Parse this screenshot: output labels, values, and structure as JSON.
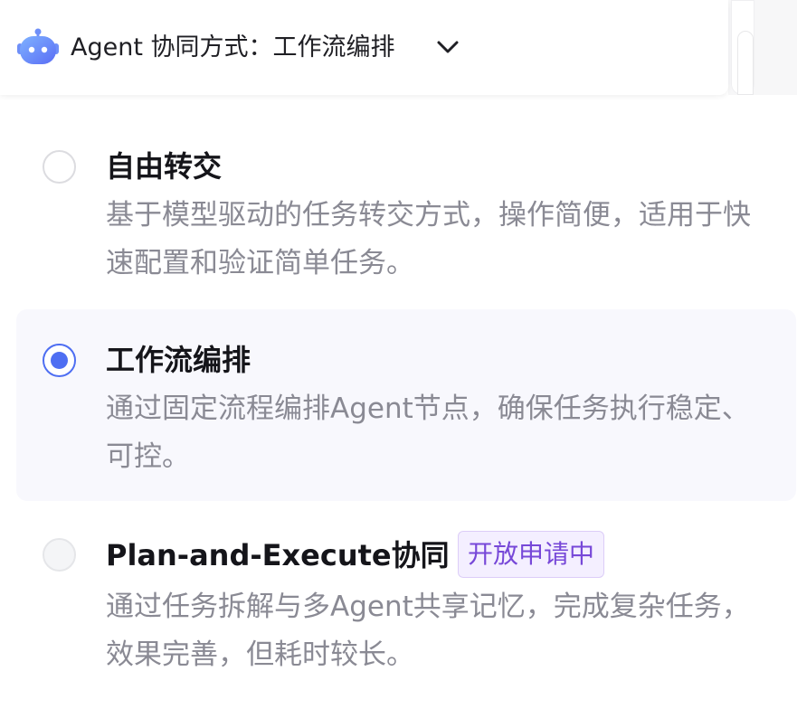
{
  "header": {
    "title": "Agent 协同方式：工作流编排",
    "bot_icon": "robot-icon",
    "chevron_icon": "chevron-down-icon"
  },
  "options": [
    {
      "title": "自由转交",
      "description": "基于模型驱动的任务转交方式，操作简便，适用于快速配置和验证简单任务。",
      "selected": false,
      "disabled": false
    },
    {
      "title": "工作流编排",
      "description": "通过固定流程编排Agent节点，确保任务执行稳定、可控。",
      "selected": true,
      "disabled": false
    },
    {
      "title": "Plan-and-Execute协同",
      "badge": "开放申请中",
      "description": "通过任务拆解与多Agent共享记忆，完成复杂任务，效果完善，但耗时较长。",
      "selected": false,
      "disabled": true
    }
  ],
  "colors": {
    "accent": "#4e6ef2",
    "badge_text": "#7748d8",
    "badge_bg": "#f4efff",
    "description": "#8a8a94",
    "selected_bg": "#f8f8fd"
  }
}
